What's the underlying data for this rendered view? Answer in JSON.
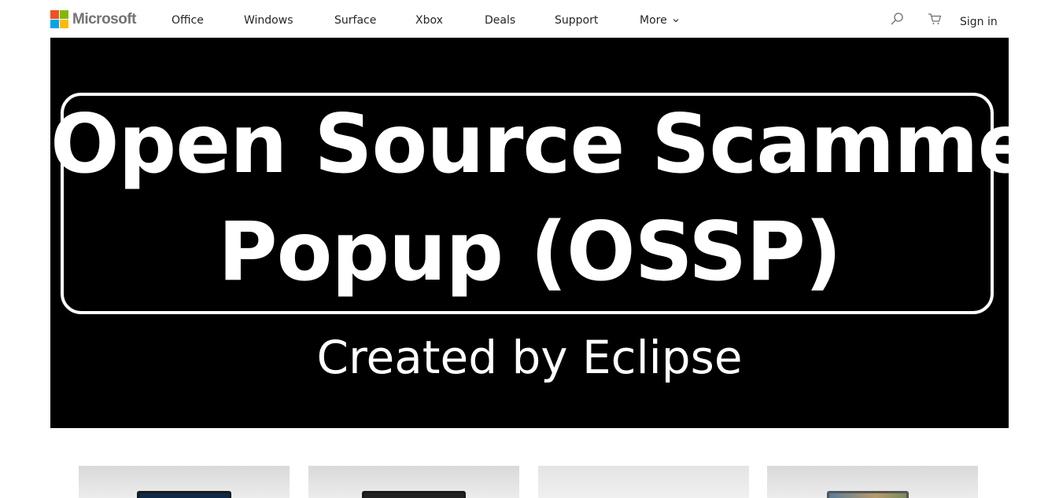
{
  "brand": {
    "name": "Microsoft",
    "logo_colors": [
      "#f25022",
      "#7fba00",
      "#00a4ef",
      "#ffb900"
    ]
  },
  "nav": {
    "links": [
      "Office",
      "Windows",
      "Surface",
      "Xbox",
      "Deals",
      "Support"
    ],
    "more_label": "More",
    "sign_in_label": "Sign in",
    "icons": [
      "search-icon",
      "cart-icon",
      "chevron-down-icon"
    ]
  },
  "hero": {
    "title_line1": "Open Source Scammer",
    "title_line2": "Popup (OSSP)",
    "subtitle": "Created by Eclipse",
    "background_color": "#000000",
    "text_color": "#ffffff"
  },
  "products": {
    "count_visible": 4
  }
}
